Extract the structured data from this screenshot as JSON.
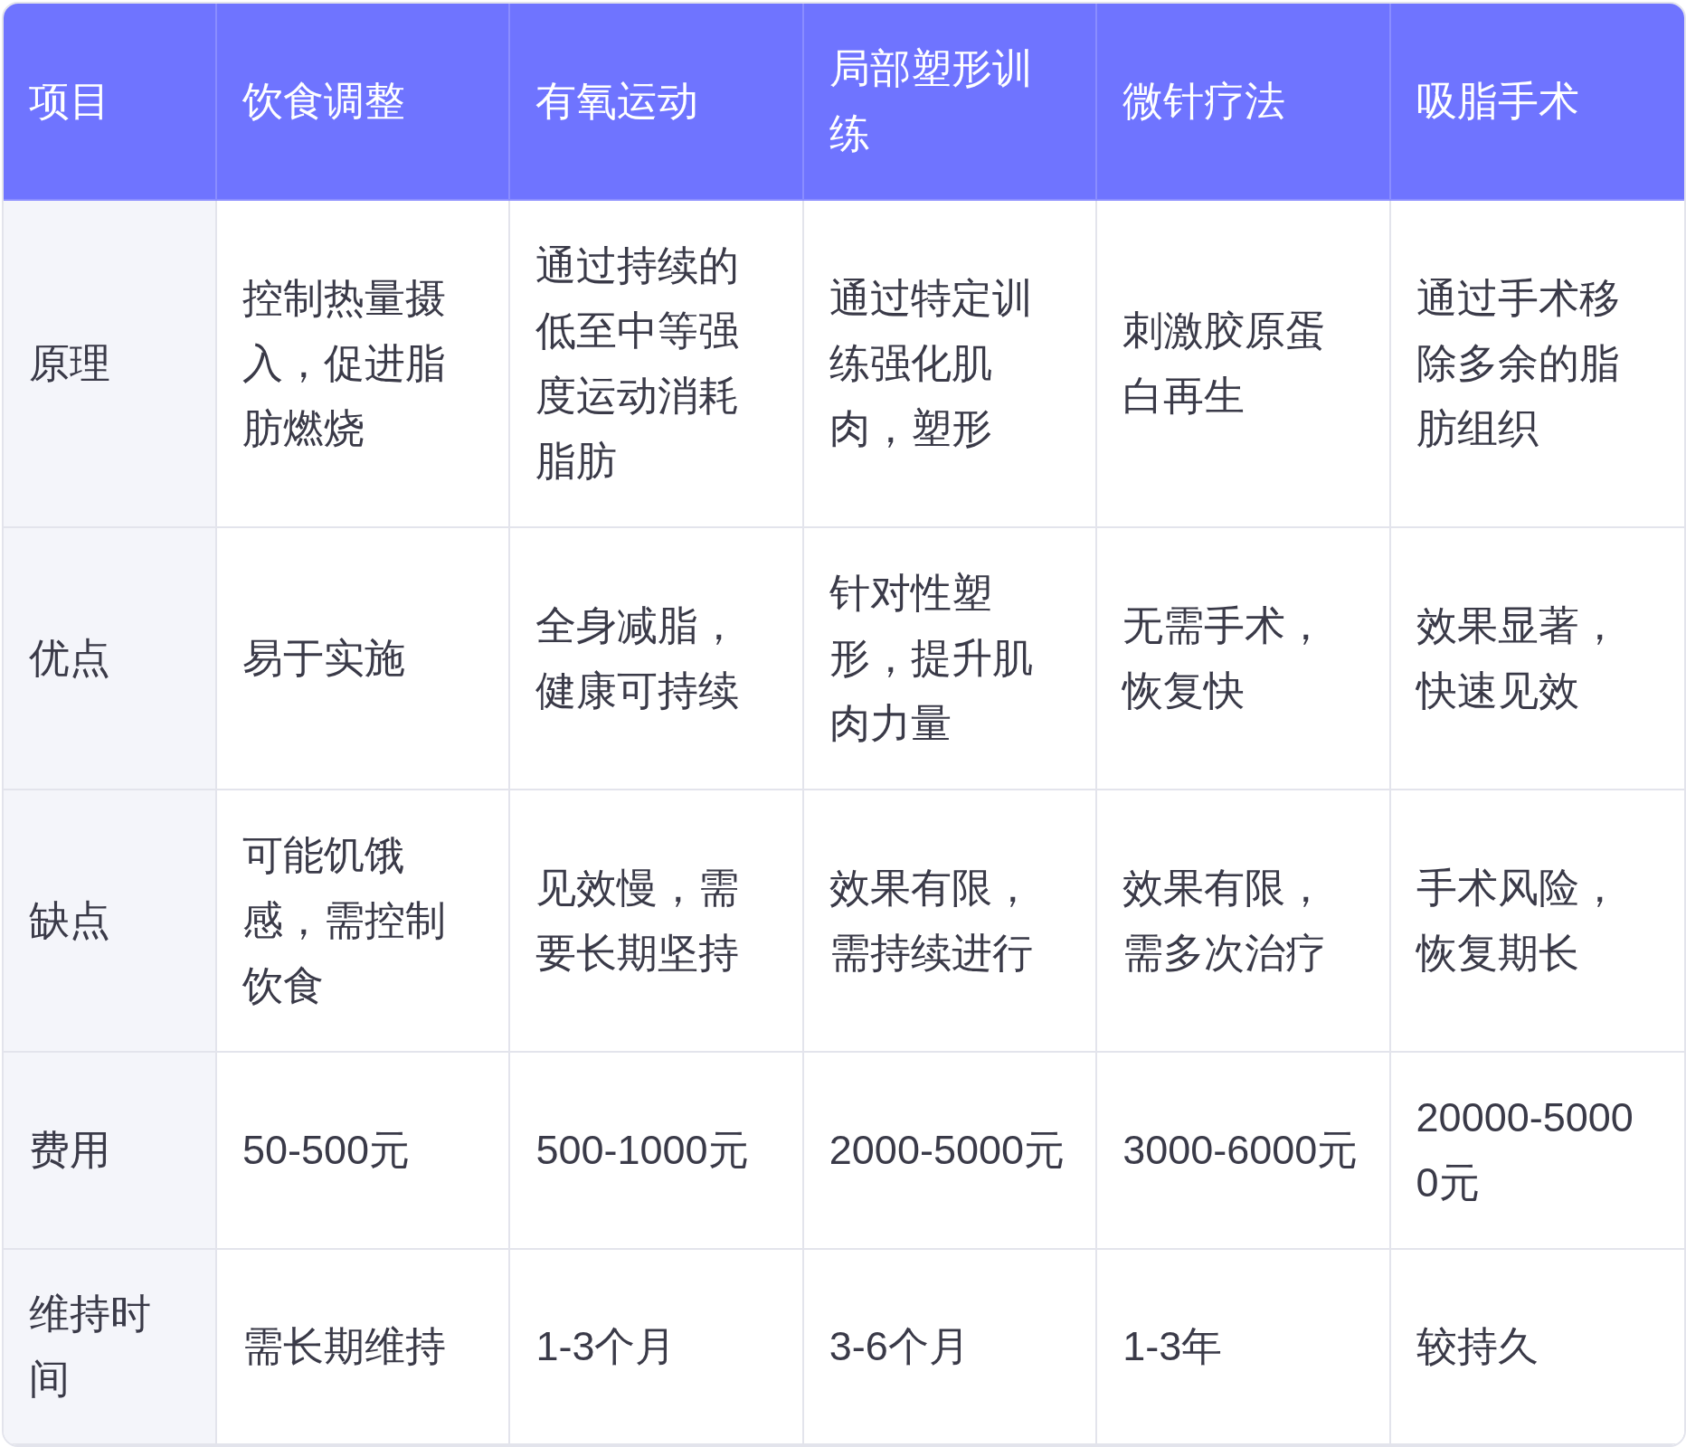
{
  "table": {
    "columns": [
      "项目",
      "饮食调整",
      "有氧运动",
      "局部塑形训练",
      "微针疗法",
      "吸脂手术"
    ],
    "rows": [
      {
        "cells": [
          "原理",
          "控制热量摄入，促进脂肪燃烧",
          "通过持续的低至中等强度运动消耗脂肪",
          "通过特定训练强化肌肉，塑形",
          "刺激胶原蛋白再生",
          "通过手术移除多余的脂肪组织"
        ]
      },
      {
        "cells": [
          "优点",
          "易于实施",
          "全身减脂，健康可持续",
          "针对性塑形，提升肌肉力量",
          "无需手术，恢复快",
          "效果显著，快速见效"
        ]
      },
      {
        "cells": [
          "缺点",
          "可能饥饿感，需控制饮食",
          "见效慢，需要长期坚持",
          "效果有限，需持续进行",
          "效果有限，需多次治疗",
          "手术风险，恢复期长"
        ]
      },
      {
        "cells": [
          "费用",
          "50-500元",
          "500-1000元",
          "2000-5000元",
          "3000-6000元",
          "20000-50000元"
        ]
      },
      {
        "cells": [
          "维持时间",
          "需长期维持",
          "1-3个月",
          "3-6个月",
          "1-3年",
          "较持久"
        ]
      }
    ]
  }
}
